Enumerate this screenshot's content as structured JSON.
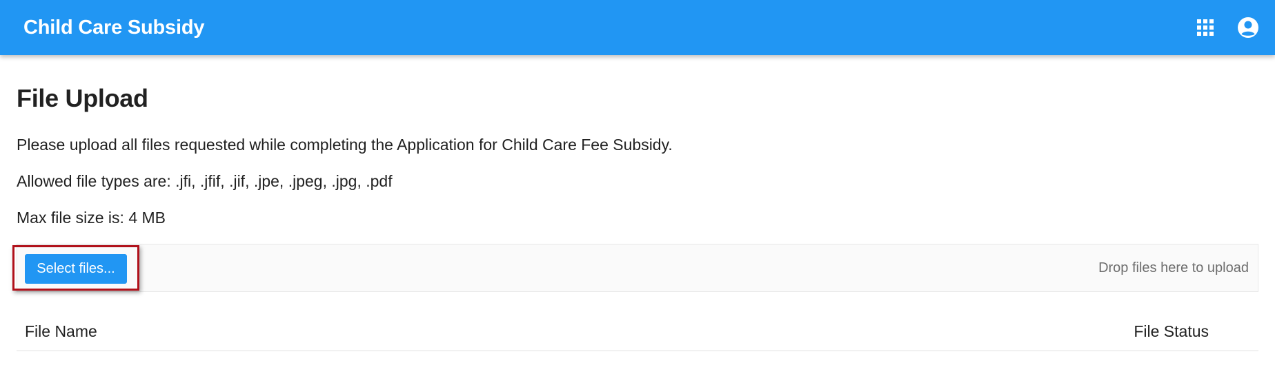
{
  "app_bar": {
    "title": "Child Care Subsidy",
    "apps_icon": "apps-grid-icon",
    "account_icon": "account-circle-icon",
    "background_color": "#2196f3"
  },
  "page": {
    "title": "File Upload",
    "instructions": "Please upload all files requested while completing the Application for Child Care Fee Subsidy.",
    "allowed_types": "Allowed file types are: .jfi, .jfif, .jif, .jpe, .jpeg, .jpg, .pdf",
    "max_size": "Max file size is: 4 MB"
  },
  "upload": {
    "select_label": "Select files...",
    "drop_hint": "Drop files here to upload",
    "highlight_color": "#b0101a"
  },
  "file_table": {
    "columns": [
      "File Name",
      "File Status"
    ]
  }
}
